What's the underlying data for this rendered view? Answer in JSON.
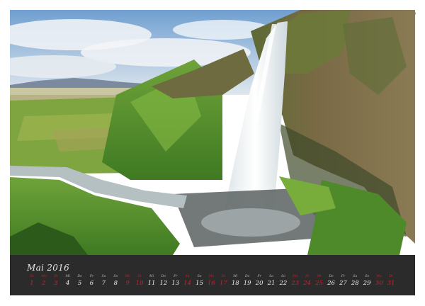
{
  "calendar": {
    "month_label": "Mai 2016",
    "days": [
      {
        "wd": "So",
        "num": "1",
        "weekend": true
      },
      {
        "wd": "Mo",
        "num": "2",
        "weekend": true
      },
      {
        "wd": "Di",
        "num": "3",
        "weekend": true
      },
      {
        "wd": "Mi",
        "num": "4",
        "weekend": false
      },
      {
        "wd": "Do",
        "num": "5",
        "weekend": false
      },
      {
        "wd": "Fr",
        "num": "6",
        "weekend": false
      },
      {
        "wd": "Sa",
        "num": "7",
        "weekend": false
      },
      {
        "wd": "So",
        "num": "8",
        "weekend": false
      },
      {
        "wd": "Mo",
        "num": "9",
        "weekend": true
      },
      {
        "wd": "Di",
        "num": "10",
        "weekend": true
      },
      {
        "wd": "Mi",
        "num": "11",
        "weekend": false
      },
      {
        "wd": "Do",
        "num": "12",
        "weekend": false
      },
      {
        "wd": "Fr",
        "num": "13",
        "weekend": false
      },
      {
        "wd": "Sa",
        "num": "14",
        "weekend": true
      },
      {
        "wd": "So",
        "num": "15",
        "weekend": false
      },
      {
        "wd": "Mo",
        "num": "16",
        "weekend": true
      },
      {
        "wd": "Di",
        "num": "17",
        "weekend": true
      },
      {
        "wd": "Mi",
        "num": "18",
        "weekend": false
      },
      {
        "wd": "Do",
        "num": "19",
        "weekend": false
      },
      {
        "wd": "Fr",
        "num": "20",
        "weekend": false
      },
      {
        "wd": "Sa",
        "num": "21",
        "weekend": false
      },
      {
        "wd": "So",
        "num": "22",
        "weekend": false
      },
      {
        "wd": "Mo",
        "num": "23",
        "weekend": true
      },
      {
        "wd": "Di",
        "num": "24",
        "weekend": true
      },
      {
        "wd": "Mi",
        "num": "25",
        "weekend": true
      },
      {
        "wd": "Do",
        "num": "26",
        "weekend": false
      },
      {
        "wd": "Fr",
        "num": "27",
        "weekend": false
      },
      {
        "wd": "Sa",
        "num": "28",
        "weekend": false
      },
      {
        "wd": "So",
        "num": "29",
        "weekend": false
      },
      {
        "wd": "Mo",
        "num": "30",
        "weekend": true
      },
      {
        "wd": "Di",
        "num": "31",
        "weekend": true
      }
    ],
    "colors": {
      "panel": "#2b2b2b",
      "text": "#efefef",
      "accent": "#c0262d"
    }
  }
}
